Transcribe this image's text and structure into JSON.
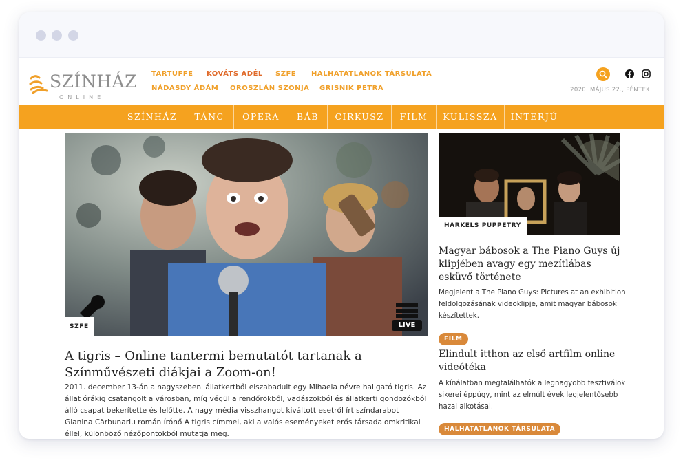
{
  "logo": {
    "main": "SZÍNHÁZ",
    "sub": "ONLINE"
  },
  "tags": {
    "row1": [
      "TARTUFFE",
      "KOVÁTS ADÉL",
      "SZFE",
      "HALHATATLANOK TÁRSULATA"
    ],
    "row2": [
      "NÁDASDY ÁDÁM",
      "OROSZLÁN SZONJA",
      "GRISNIK PETRA"
    ]
  },
  "header": {
    "date": "2020. MÁJUS 22., PÉNTEK",
    "search_icon": "search-icon",
    "social": [
      "facebook-icon",
      "instagram-icon"
    ]
  },
  "nav": [
    "SZÍNHÁZ",
    "TÁNC",
    "OPERA",
    "BÁB",
    "CIRKUSZ",
    "FILM",
    "KULISSZA",
    "INTERJÚ"
  ],
  "colors": {
    "accent": "#f5a21f",
    "pill": "#d9893a",
    "tag": "#f0a02a",
    "tag_highlight": "#e06a2a"
  },
  "main_article": {
    "category": "SZFE",
    "title": "A tigris – Online tantermi bemutatót tartanak a Színművészeti diákjai a Zoom-on!",
    "text": "2011. december 13-án a nagyszebeni állatkertből elszabadult egy Mihaela névre hallgató tigris. Az állat órákig csatangolt a városban, míg végül a rendőrökből, vadászokból és állatkerti gondozókból álló csapat bekerítette és lelőtte. A nagy média visszhangot kiváltott esetről írt színdarabot Gianina Cărbunariu román írónő A tigris címmel, aki a valós eseményeket erős társadalomkritikai éllel, különböző nézőpontokból mutatja meg.",
    "overlay": "LIVE"
  },
  "side_articles": [
    {
      "category": "HARKELS PUPPETRY",
      "title": "Magyar bábosok a The Piano Guys új klipjében avagy egy mezítlábas esküvő története",
      "text": "Megjelent a The Piano Guys: Pictures at an exhibition feldolgozásának videoklipje, amit magyar bábosok készítettek."
    },
    {
      "category": "FILM",
      "title": "Elindult itthon az első artfilm online videótéka",
      "text": "A kínálatban megtalálhatók a legnagyobb fesztiválok sikerei éppúgy, mint az elmúlt évek legjelentősebb hazai alkotásai."
    },
    {
      "category": "HALHATATLANOK TÁRSULATA"
    }
  ]
}
